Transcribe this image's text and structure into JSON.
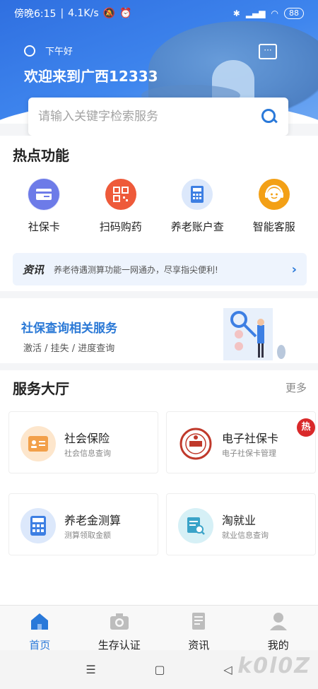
{
  "status_bar": {
    "time": "傍晚6:15",
    "speed": "4.1K/s",
    "battery": "88"
  },
  "header": {
    "greeting": "下午好",
    "welcome": "欢迎来到广西12333"
  },
  "search": {
    "placeholder": "请输入关键字检索服务"
  },
  "hot_functions": {
    "title": "热点功能",
    "items": [
      {
        "label": "社保卡",
        "icon": "social-card-icon",
        "color": "#6d7be8"
      },
      {
        "label": "扫码购药",
        "icon": "qr-code-icon",
        "color": "#ee5a3a"
      },
      {
        "label": "养老账户查",
        "icon": "calculator-icon",
        "color": "#3d7fe3"
      },
      {
        "label": "智能客服",
        "icon": "customer-service-icon",
        "color": "#f3a016"
      }
    ]
  },
  "news": {
    "tag": "资讯",
    "text": "养老待遇测算功能一网通办，尽享指尖便利!"
  },
  "banner": {
    "title": "社保查询相关服务",
    "subtitle": "激活 / 挂失 / 进度查询"
  },
  "service_hall": {
    "title": "服务大厅",
    "more": "更多",
    "badge": "热",
    "cards": [
      {
        "title": "社会保险",
        "subtitle": "社会信息查询",
        "icon": "id-card-icon"
      },
      {
        "title": "电子社保卡",
        "subtitle": "电子社保卡管理",
        "icon": "seal-icon"
      },
      {
        "title": "养老金测算",
        "subtitle": "测算领取金额",
        "icon": "calculator-icon"
      },
      {
        "title": "淘就业",
        "subtitle": "就业信息查询",
        "icon": "job-search-icon"
      }
    ]
  },
  "tabbar": {
    "tabs": [
      {
        "label": "首页",
        "icon": "home-icon",
        "active": true
      },
      {
        "label": "生存认证",
        "icon": "camera-icon",
        "active": false
      },
      {
        "label": "资讯",
        "icon": "news-icon",
        "active": false
      },
      {
        "label": "我的",
        "icon": "user-icon",
        "active": false
      }
    ]
  },
  "watermark": "k0l0Z"
}
